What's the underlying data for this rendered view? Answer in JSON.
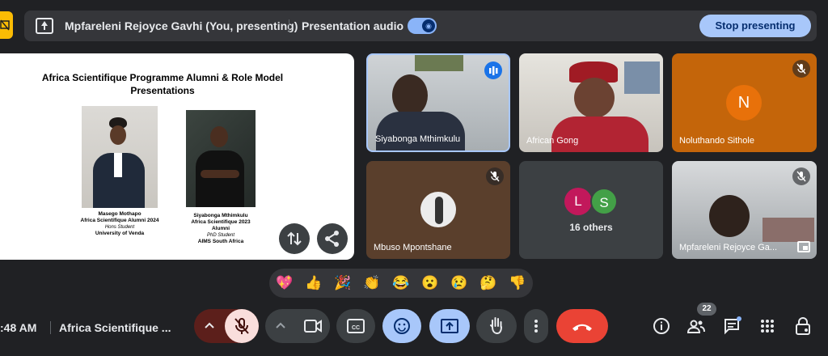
{
  "top_bar": {
    "presenter_label": "Mpfareleni Rejoyce Gavhi (You, presenting)",
    "audio_label": "Presentation audio",
    "audio_enabled": true,
    "stop_button": "Stop presenting"
  },
  "slide": {
    "title": "Africa Scientifique Programme Alumni & Role Model Presentations",
    "people": [
      {
        "name": "Masego Mothapo",
        "line1": "Africa Scientifique Alumni 2024",
        "line2": "Hons Student",
        "line3": "University of Venda"
      },
      {
        "name": "Siyabonga Mthimkulu",
        "line1": "Africa Scientifique 2023",
        "line2": "Alumni",
        "line3": "PhD Student",
        "line4": "AIMS South Africa"
      }
    ]
  },
  "participants": [
    {
      "name": "Siyabonga Mthimkulu",
      "speaking": true
    },
    {
      "name": "African Gong"
    },
    {
      "name": "Noluthando Sithole",
      "initial": "N",
      "muted": true
    },
    {
      "name": "Mbuso Mpontshane",
      "muted": true
    },
    {
      "others_label": "16 others",
      "initials": [
        "L",
        "S"
      ]
    },
    {
      "name": "Mpfareleni Rejoyce Ga...",
      "muted": true
    }
  ],
  "reactions": [
    "💖",
    "👍",
    "🎉",
    "👏",
    "😂",
    "😮",
    "😢",
    "🤔",
    "👎"
  ],
  "bottom": {
    "time": ":48 AM",
    "meeting_title": "Africa Scientifique ...",
    "participant_count": "22"
  },
  "colors": {
    "accent": "#a8c7fa",
    "end_call": "#ea4335",
    "mic_off": "#f9dedc",
    "avatar_n": "#e8710a",
    "avatar_l": "#c2185b",
    "avatar_s": "#43a047"
  }
}
